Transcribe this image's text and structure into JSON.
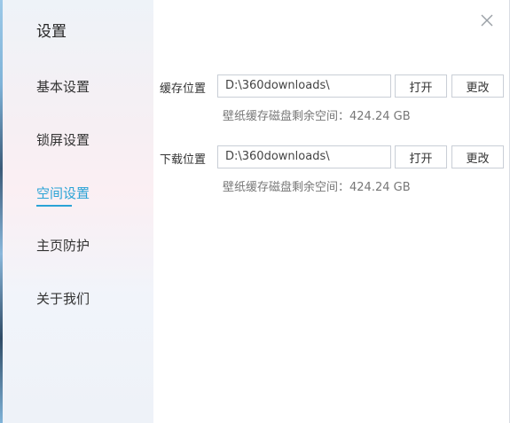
{
  "sidebar": {
    "title": "设置",
    "items": [
      {
        "label": "基本设置",
        "active": false
      },
      {
        "label": "锁屏设置",
        "active": false
      },
      {
        "label": "空间设置",
        "active": true
      },
      {
        "label": "主页防护",
        "active": false
      },
      {
        "label": "关于我们",
        "active": false
      }
    ]
  },
  "window": {
    "close_icon": "close-icon"
  },
  "cache": {
    "label": "缓存位置",
    "path": "D:\\360downloads\\",
    "open_label": "打开",
    "change_label": "更改",
    "info": "壁纸缓存磁盘剩余空间：424.24 GB"
  },
  "download": {
    "label": "下载位置",
    "path": "D:\\360downloads\\",
    "open_label": "打开",
    "change_label": "更改",
    "info": "壁纸缓存磁盘剩余空间：424.24 GB"
  },
  "colors": {
    "accent": "#2aa3d6"
  }
}
